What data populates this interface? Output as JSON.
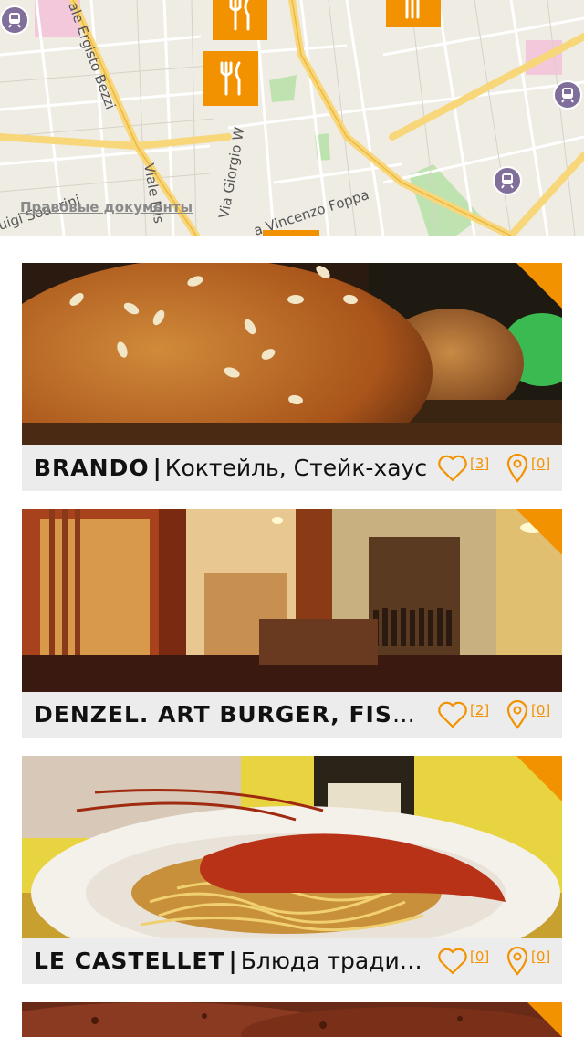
{
  "map": {
    "legal_link": "Правовые документы"
  },
  "separator": "|",
  "restaurants": [
    {
      "name": "BRANDO",
      "categories": "Коктейль, Стейк-хаус",
      "likes": "[3]",
      "checkins": "[0]"
    },
    {
      "name": "DENZEL. ART BURGER, FISH & WINE",
      "categories": "",
      "likes": "[2]",
      "checkins": "[0]"
    },
    {
      "name": "LE CASTELLET",
      "categories": "Блюда традиционной кухни",
      "likes": "[0]",
      "checkins": "[0]"
    }
  ],
  "colors": {
    "accent": "#f39200",
    "info_bar": "#ececec",
    "transit": "#7f6f9a"
  },
  "icons": [
    "cutlery-icon",
    "transit-station-icon",
    "heart-icon",
    "location-pin-icon"
  ]
}
